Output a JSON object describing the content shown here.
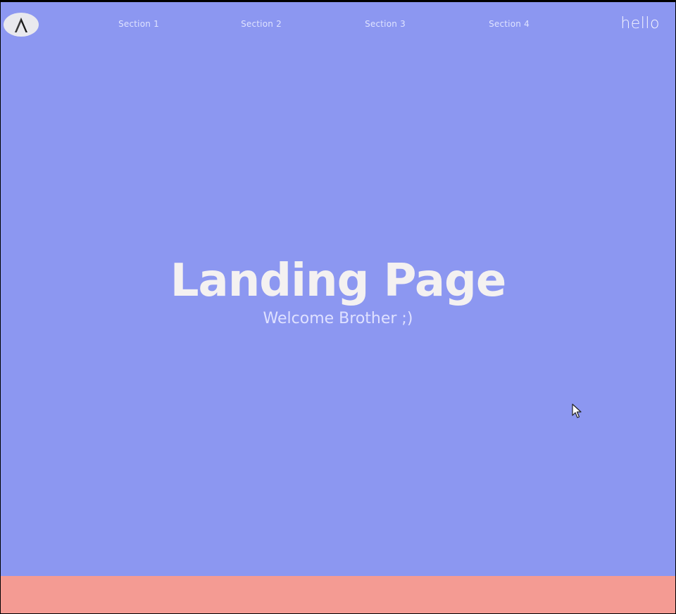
{
  "nav": {
    "logo_icon": "caret-a-logo-icon",
    "links": [
      {
        "label": "Section 1"
      },
      {
        "label": "Section 2"
      },
      {
        "label": "Section 3"
      },
      {
        "label": "Section 4"
      }
    ],
    "right_text": "hello"
  },
  "hero": {
    "title": "Landing Page",
    "subtitle": "Welcome Brother ;)"
  },
  "colors": {
    "hero_background": "#8c97f1",
    "footer_band": "#f49b93",
    "text_light": "#f4f1f1",
    "logo_background": "#e9e9ee"
  },
  "cursor_icon": "mouse-pointer-icon"
}
